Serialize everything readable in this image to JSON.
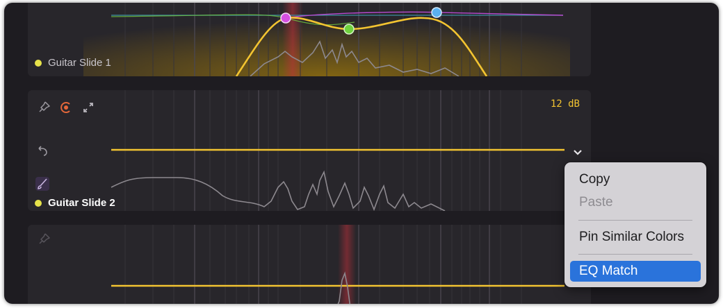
{
  "tracks": [
    {
      "name": "Guitar Slide 1",
      "color": "#e6e24a"
    },
    {
      "name": "Guitar Slide 2",
      "color": "#e6e24a",
      "gain_label": "12 dB"
    },
    {
      "name": "",
      "color": "#e6e24a"
    }
  ],
  "icons": {
    "pin": "pin-icon",
    "record": "record-icon",
    "expand": "expand-icon",
    "undo": "undo-icon",
    "brush": "brush-icon",
    "chevron": "chevron-down-icon"
  },
  "eq_nodes": [
    {
      "color": "#d54fe0"
    },
    {
      "color": "#6fd13e"
    },
    {
      "color": "#5ab0f0"
    }
  ],
  "context_menu": {
    "items": [
      {
        "label": "Copy",
        "enabled": true
      },
      {
        "label": "Paste",
        "enabled": false
      },
      {
        "label": "Pin Similar Colors",
        "enabled": true
      },
      {
        "label": "EQ Match",
        "enabled": true,
        "selected": true
      }
    ]
  },
  "colors": {
    "accent": "#f3c431",
    "selection": "#2a73db",
    "background": "#1e1c21",
    "panel": "#28262b"
  }
}
